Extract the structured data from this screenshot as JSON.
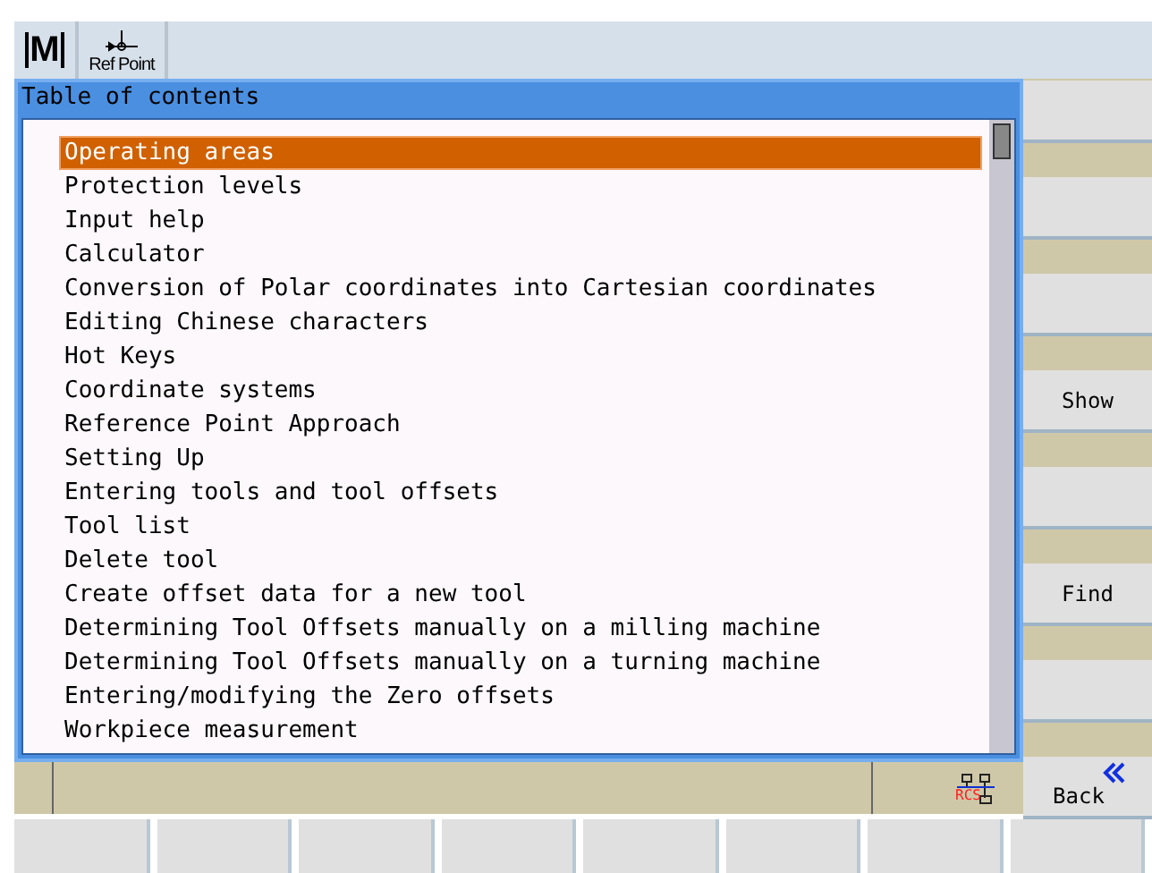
{
  "header": {
    "buttons": [
      {
        "kind": "mode",
        "label": "M"
      },
      {
        "kind": "refpoint",
        "label": "Ref Point"
      }
    ]
  },
  "dialog": {
    "title": "Table of contents",
    "items": [
      {
        "label": "Operating areas",
        "selected": true
      },
      {
        "label": "Protection levels",
        "selected": false
      },
      {
        "label": "Input help",
        "selected": false
      },
      {
        "label": "Calculator",
        "selected": false
      },
      {
        "label": "Conversion of Polar coordinates into Cartesian coordinates",
        "selected": false
      },
      {
        "label": "Editing Chinese characters",
        "selected": false
      },
      {
        "label": "Hot Keys",
        "selected": false
      },
      {
        "label": "Coordinate systems",
        "selected": false
      },
      {
        "label": "Reference Point Approach",
        "selected": false
      },
      {
        "label": "Setting Up",
        "selected": false
      },
      {
        "label": "Entering tools and tool offsets",
        "selected": false
      },
      {
        "label": "Tool list",
        "selected": false
      },
      {
        "label": "Delete tool",
        "selected": false
      },
      {
        "label": "Create offset data for a new tool",
        "selected": false
      },
      {
        "label": "Determining Tool Offsets manually on a milling machine",
        "selected": false
      },
      {
        "label": "Determining Tool Offsets manually on a turning machine",
        "selected": false
      },
      {
        "label": "Entering/modifying the Zero offsets",
        "selected": false
      },
      {
        "label": "Workpiece measurement",
        "selected": false
      }
    ]
  },
  "status_bar": {
    "rcs_label": "RCS"
  },
  "vertical_softkeys": [
    {
      "kind": "blank"
    },
    {
      "kind": "blank"
    },
    {
      "kind": "blank"
    },
    {
      "kind": "text",
      "label": "Show"
    },
    {
      "kind": "blank"
    },
    {
      "kind": "text",
      "label": "Find"
    },
    {
      "kind": "blank"
    },
    {
      "kind": "back",
      "label": "Back"
    }
  ],
  "horizontal_softkeys": [
    {
      "kind": "blank"
    },
    {
      "kind": "blank"
    },
    {
      "kind": "blank"
    },
    {
      "kind": "blank"
    },
    {
      "kind": "blank"
    },
    {
      "kind": "blank"
    },
    {
      "kind": "blank"
    },
    {
      "kind": "blank"
    }
  ]
}
